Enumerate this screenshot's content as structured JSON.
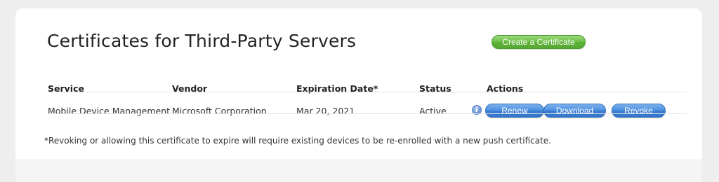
{
  "page": {
    "title": "Certificates for Third-Party Servers",
    "create_button_label": "Create a Certificate"
  },
  "table": {
    "columns": [
      "Service",
      "Vendor",
      "Expiration Date*",
      "Status",
      "Actions"
    ],
    "rows": [
      {
        "service": "Mobile Device Management",
        "vendor": "Microsoft Corporation",
        "expiration_date": "Mar 20, 2021",
        "status": "Active",
        "info_icon": "info-icon",
        "actions": [
          "Renew",
          "Download",
          "Revoke"
        ]
      }
    ]
  },
  "footnote": "*Revoking or allowing this certificate to expire will require existing devices to be re-enrolled with a new push certificate.",
  "colors": {
    "primary_button": "#4a8fdf",
    "create_button": "#6cbf45",
    "background": "#eeeeee",
    "card": "#ffffff"
  }
}
